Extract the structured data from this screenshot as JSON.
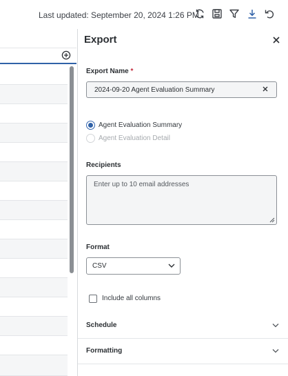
{
  "toolbar": {
    "last_updated": "Last updated: September 20, 2024 1:26 PM",
    "icons": [
      "refresh-icon",
      "save-icon",
      "filter-icon",
      "download-icon",
      "undo-icon"
    ],
    "accent_color": "#2f61a7"
  },
  "table": {
    "add_column_icon": "plus-circle-icon"
  },
  "export_panel": {
    "title": "Export",
    "close_icon": "close-icon",
    "export_name": {
      "label": "Export Name",
      "required_marker": "*",
      "value": "2024-09-20 Agent Evaluation Summary",
      "clear_icon": "clear-icon"
    },
    "report_type": {
      "options": [
        {
          "label": "Agent Evaluation Summary",
          "selected": true,
          "disabled": false
        },
        {
          "label": "Agent Evaluation Detail",
          "selected": false,
          "disabled": true
        }
      ]
    },
    "recipients": {
      "label": "Recipients",
      "placeholder": "Enter up to 10 email addresses",
      "value": ""
    },
    "format": {
      "label": "Format",
      "selected": "CSV"
    },
    "include_all_columns": {
      "label": "Include all columns",
      "checked": false
    },
    "sections": [
      {
        "label": "Schedule"
      },
      {
        "label": "Formatting"
      }
    ]
  }
}
